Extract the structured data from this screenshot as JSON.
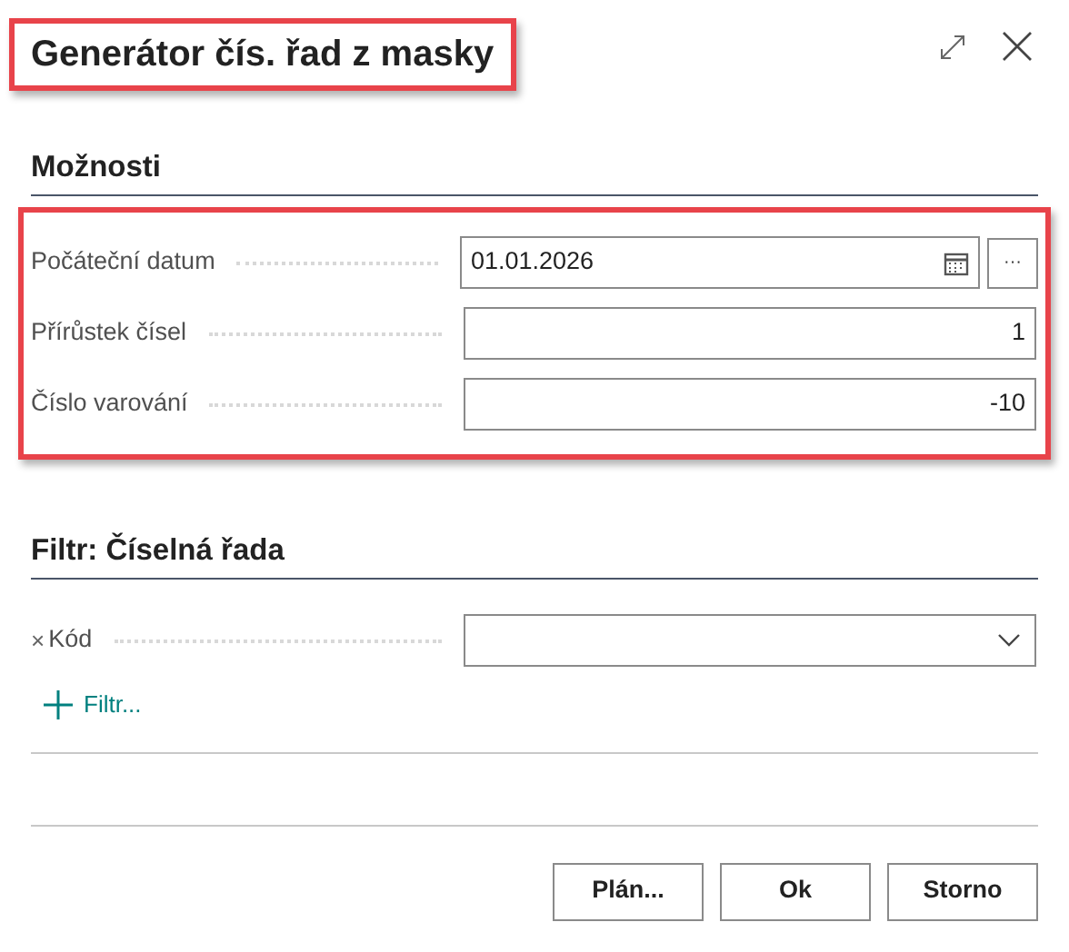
{
  "dialog": {
    "title": "Generátor čís. řad z masky",
    "title_highlighted": true
  },
  "options": {
    "heading": "Možnosti",
    "highlighted": true,
    "fields": [
      {
        "kind": "date",
        "label": "Počáteční datum",
        "value": "01.01.2026",
        "button": "···"
      },
      {
        "kind": "number",
        "label": "Přírůstek čísel",
        "value": "1"
      },
      {
        "kind": "number",
        "label": "Číslo varování",
        "value": "-10"
      }
    ]
  },
  "filter": {
    "heading": "Filtr: Číselná řada",
    "fields": [
      {
        "kind": "dropdown",
        "remove": "×",
        "label": "Kód"
      }
    ],
    "add_link": "Filtr..."
  },
  "buttons": [
    {
      "label": "Plán..."
    },
    {
      "label": "Ok"
    },
    {
      "label": "Storno"
    }
  ]
}
